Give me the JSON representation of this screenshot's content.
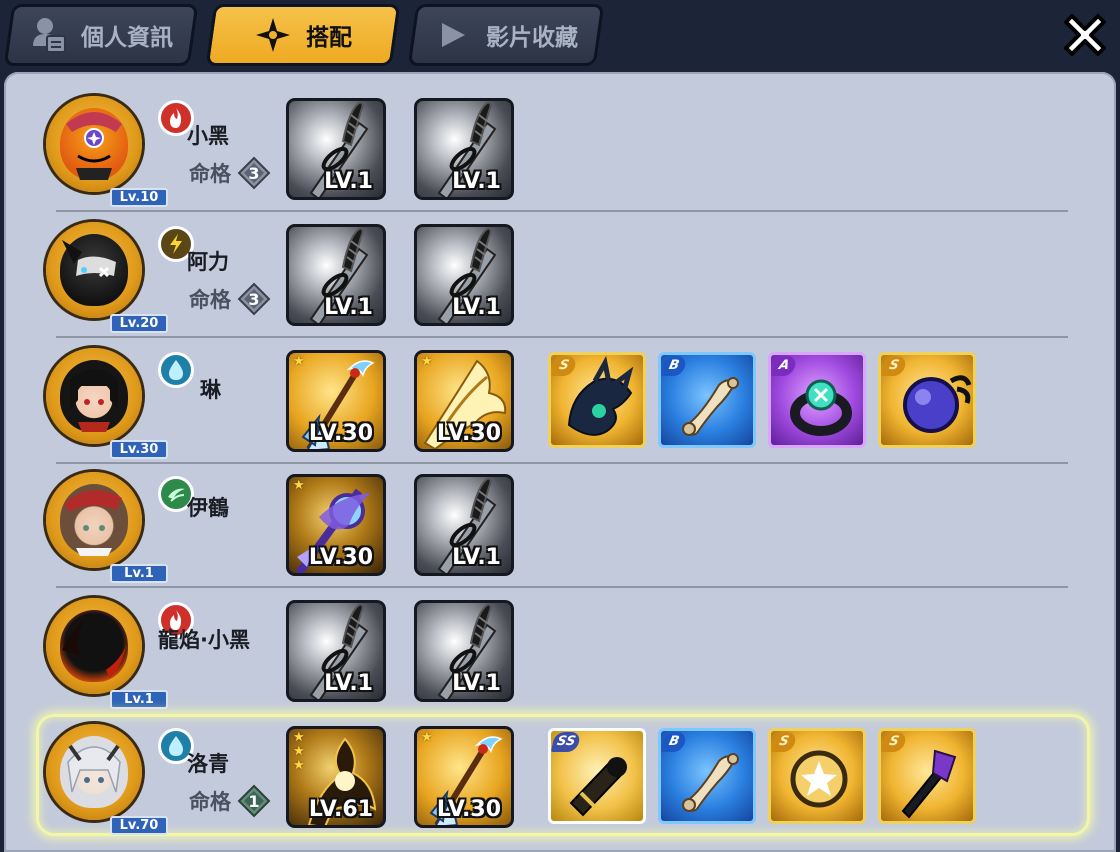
{
  "tabs": [
    {
      "label": "個人資訊",
      "icon": "profile-card-icon",
      "active": false
    },
    {
      "label": "搭配",
      "icon": "four-point-star-icon",
      "active": true
    },
    {
      "label": "影片收藏",
      "icon": "play-icon",
      "active": false
    }
  ],
  "close": {
    "icon": "close-icon"
  },
  "fate_label": "命格",
  "characters": [
    {
      "name": "小黑",
      "level": "Lv.10",
      "element": "fire",
      "fate": "3",
      "weapons": [
        {
          "level": "LV.1",
          "type": "default-sword"
        },
        {
          "level": "LV.1",
          "type": "default-sword"
        }
      ],
      "gear": []
    },
    {
      "name": "阿力",
      "level": "Lv.20",
      "element": "lightning",
      "fate": "3",
      "weapons": [
        {
          "level": "LV.1",
          "type": "default-sword"
        },
        {
          "level": "LV.1",
          "type": "default-sword"
        }
      ],
      "gear": []
    },
    {
      "name": "琳",
      "level": "Lv.30",
      "element": "water",
      "fate": null,
      "weapons": [
        {
          "level": "LV.30",
          "type": "ice-trident",
          "stars": 1
        },
        {
          "level": "LV.30",
          "type": "golden-blade",
          "stars": 1
        }
      ],
      "gear": [
        {
          "grade": "S",
          "icon": "dark-claw-icon"
        },
        {
          "grade": "B",
          "icon": "scroll-icon"
        },
        {
          "grade": "A",
          "icon": "ring-icon"
        },
        {
          "grade": "S",
          "icon": "dark-orb-icon"
        }
      ]
    },
    {
      "name": "伊鶴",
      "level": "Lv.1",
      "element": "wind",
      "fate": null,
      "weapons": [
        {
          "level": "LV.30",
          "type": "lightning-staff",
          "stars": 1
        },
        {
          "level": "LV.1",
          "type": "default-sword"
        }
      ],
      "gear": []
    },
    {
      "name": "龍焰·小黑",
      "level": "Lv.1",
      "element": "fire",
      "fate": null,
      "weapons": [
        {
          "level": "LV.1",
          "type": "default-sword"
        },
        {
          "level": "LV.1",
          "type": "default-sword"
        }
      ],
      "gear": []
    },
    {
      "name": "洛青",
      "level": "Lv.70",
      "element": "water",
      "fate": "1",
      "selected": true,
      "weapons": [
        {
          "level": "LV.61",
          "type": "dark-spirit",
          "stars": 3
        },
        {
          "level": "LV.30",
          "type": "ice-trident",
          "stars": 1
        }
      ],
      "gear": [
        {
          "grade": "SS",
          "icon": "cannon-icon"
        },
        {
          "grade": "B",
          "icon": "scroll-icon"
        },
        {
          "grade": "S",
          "icon": "star-emblem-icon"
        },
        {
          "grade": "S",
          "icon": "purple-dagger-icon"
        }
      ]
    }
  ],
  "colors": {
    "tab_active": "#F0B02C",
    "tab_inactive": "#343C4E",
    "panel": "#C3CADB",
    "level_badge": "#2F63B8",
    "selected_glow": "#F3F6A6",
    "fire": "#D0302A",
    "lightning": "#5A4616",
    "water": "#1E7FA8",
    "wind": "#2E8A4A"
  }
}
